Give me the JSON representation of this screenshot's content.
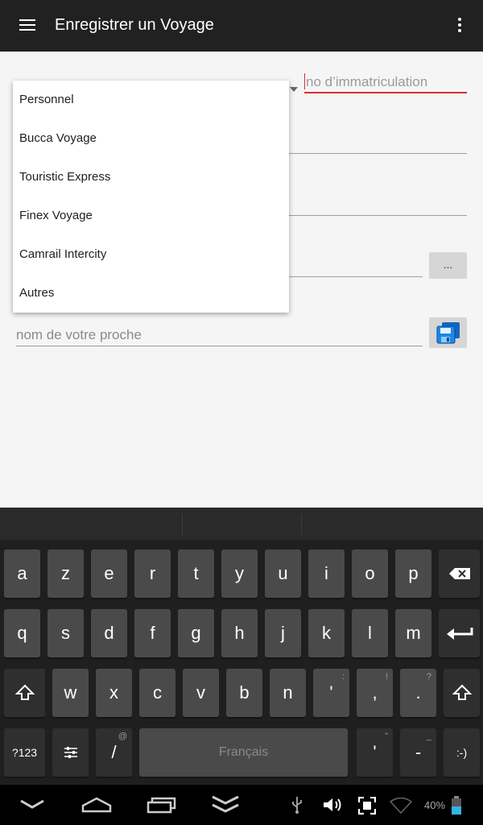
{
  "app_bar": {
    "title": "Enregistrer un Voyage",
    "menu_icon": "hamburger-icon",
    "overflow_icon": "more-vert-icon"
  },
  "form": {
    "plate_placeholder": "no d’immatriculation",
    "relative_placeholder": "nom de votre proche",
    "dots_button_label": "...",
    "save_icon": "save-icon"
  },
  "dropdown": {
    "items": [
      "Personnel",
      "Bucca Voyage",
      "Touristic Express",
      "Finex Voyage",
      "Camrail Intercity",
      "Autres"
    ]
  },
  "keyboard": {
    "row1": [
      "a",
      "z",
      "e",
      "r",
      "t",
      "y",
      "u",
      "i",
      "o",
      "p"
    ],
    "row2": [
      "q",
      "s",
      "d",
      "f",
      "g",
      "h",
      "j",
      "k",
      "l",
      "m"
    ],
    "row3": [
      "w",
      "x",
      "c",
      "v",
      "b",
      "n",
      "'",
      ",",
      "."
    ],
    "row3_hints": [
      "",
      "",
      "",
      "",
      "",
      "",
      ":",
      "!",
      "?"
    ],
    "row4": {
      "numbers": "?123",
      "slash": "/",
      "slash_hint": "@",
      "space": "Français",
      "quote": "'",
      "quote_hint": "\"",
      "dash": "-",
      "dash_hint": "_",
      "smiley": ":-)"
    }
  },
  "status": {
    "battery_percent": "40%"
  },
  "colors": {
    "accent_error": "#d32f2f",
    "app_bar": "#212121",
    "keyboard_bg": "#1f1f1f"
  }
}
